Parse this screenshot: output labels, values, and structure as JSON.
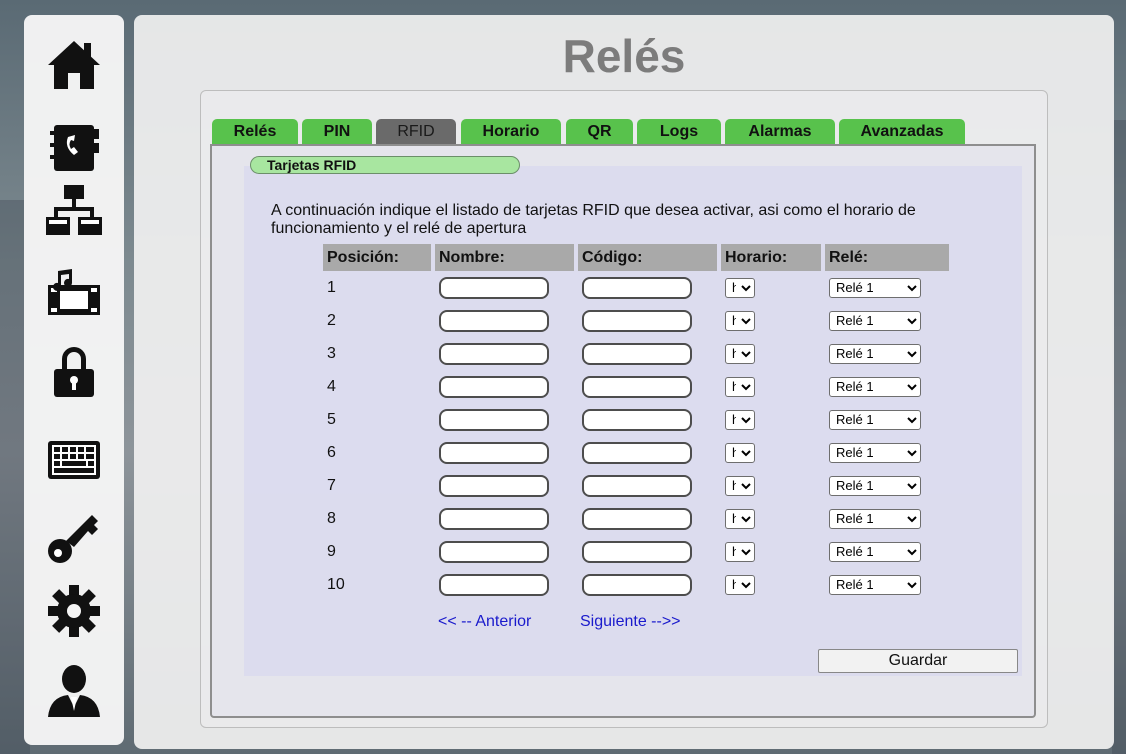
{
  "page": {
    "title": "Relés"
  },
  "sidebar": {
    "icons": [
      "home-icon",
      "contacts-icon",
      "network-icon",
      "multimedia-icon",
      "lock-icon",
      "keyboard-icon",
      "key-icon",
      "gear-icon",
      "user-icon"
    ]
  },
  "tabs": [
    {
      "label": "Relés",
      "active": false
    },
    {
      "label": "PIN",
      "active": false
    },
    {
      "label": "RFID",
      "active": true
    },
    {
      "label": "Horario",
      "active": false
    },
    {
      "label": "QR",
      "active": false
    },
    {
      "label": "Logs",
      "active": false
    },
    {
      "label": "Alarmas",
      "active": false
    },
    {
      "label": "Avanzadas",
      "active": false
    }
  ],
  "section": {
    "title": "Tarjetas RFID",
    "description": "A continuación indique el listado de tarjetas RFID que desea activar, asi como el horario de funcionamiento y el relé de apertura"
  },
  "table": {
    "headers": {
      "position": "Posición:",
      "name": "Nombre:",
      "code": "Código:",
      "schedule": "Horario:",
      "relay": "Relé:"
    },
    "rows": [
      {
        "position": "1",
        "name": "",
        "code": "",
        "schedule": "h",
        "relay": "Relé 1"
      },
      {
        "position": "2",
        "name": "",
        "code": "",
        "schedule": "h",
        "relay": "Relé 1"
      },
      {
        "position": "3",
        "name": "",
        "code": "",
        "schedule": "h",
        "relay": "Relé 1"
      },
      {
        "position": "4",
        "name": "",
        "code": "",
        "schedule": "h",
        "relay": "Relé 1"
      },
      {
        "position": "5",
        "name": "",
        "code": "",
        "schedule": "h",
        "relay": "Relé 1"
      },
      {
        "position": "6",
        "name": "",
        "code": "",
        "schedule": "h",
        "relay": "Relé 1"
      },
      {
        "position": "7",
        "name": "",
        "code": "",
        "schedule": "h",
        "relay": "Relé 1"
      },
      {
        "position": "8",
        "name": "",
        "code": "",
        "schedule": "h",
        "relay": "Relé 1"
      },
      {
        "position": "9",
        "name": "",
        "code": "",
        "schedule": "h",
        "relay": "Relé 1"
      },
      {
        "position": "10",
        "name": "",
        "code": "",
        "schedule": "h",
        "relay": "Relé 1"
      }
    ]
  },
  "pagination": {
    "prev": "<< -- Anterior",
    "next": "Siguiente -->>"
  },
  "actions": {
    "save": "Guardar"
  },
  "colors": {
    "tab": "#58c24c",
    "tab_active": "#6a6a6a",
    "pill": "#a8e6a0",
    "link": "#1a1acc",
    "title": "#7c7c7c"
  }
}
